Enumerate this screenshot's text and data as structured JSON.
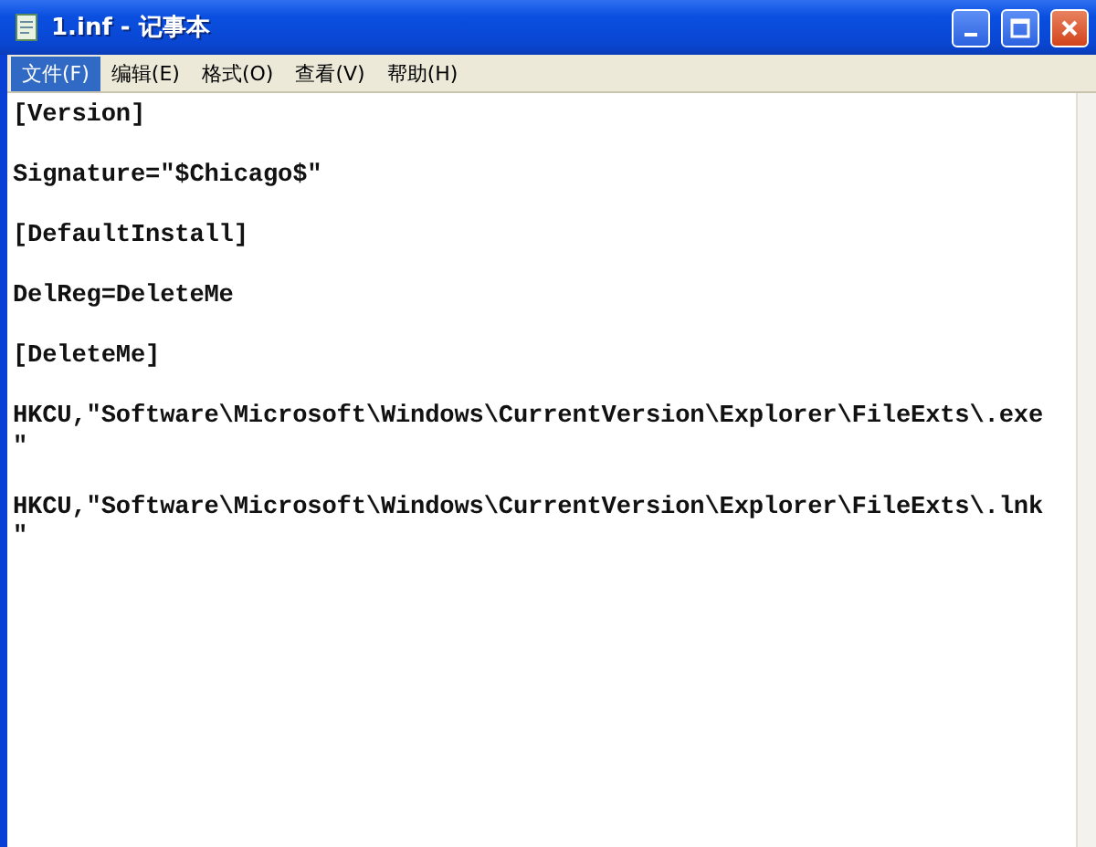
{
  "window": {
    "title": "1.inf - 记事本"
  },
  "menu": [
    {
      "label": "文件(F)",
      "selected": true
    },
    {
      "label": "编辑(E)",
      "selected": false
    },
    {
      "label": "格式(O)",
      "selected": false
    },
    {
      "label": "查看(V)",
      "selected": false
    },
    {
      "label": "帮助(H)",
      "selected": false
    }
  ],
  "editor": {
    "paragraphs": [
      [
        "[Version]"
      ],
      [
        "Signature=\"$Chicago$\""
      ],
      [
        "[DefaultInstall]"
      ],
      [
        "DelReg=DeleteMe"
      ],
      [
        "[DeleteMe]"
      ],
      [
        "HKCU,\"Software\\Microsoft\\Windows\\CurrentVersion\\Explorer\\FileExts\\.exe",
        "\""
      ],
      [
        "HKCU,\"Software\\Microsoft\\Windows\\CurrentVersion\\Explorer\\FileExts\\.lnk",
        "\""
      ]
    ]
  }
}
